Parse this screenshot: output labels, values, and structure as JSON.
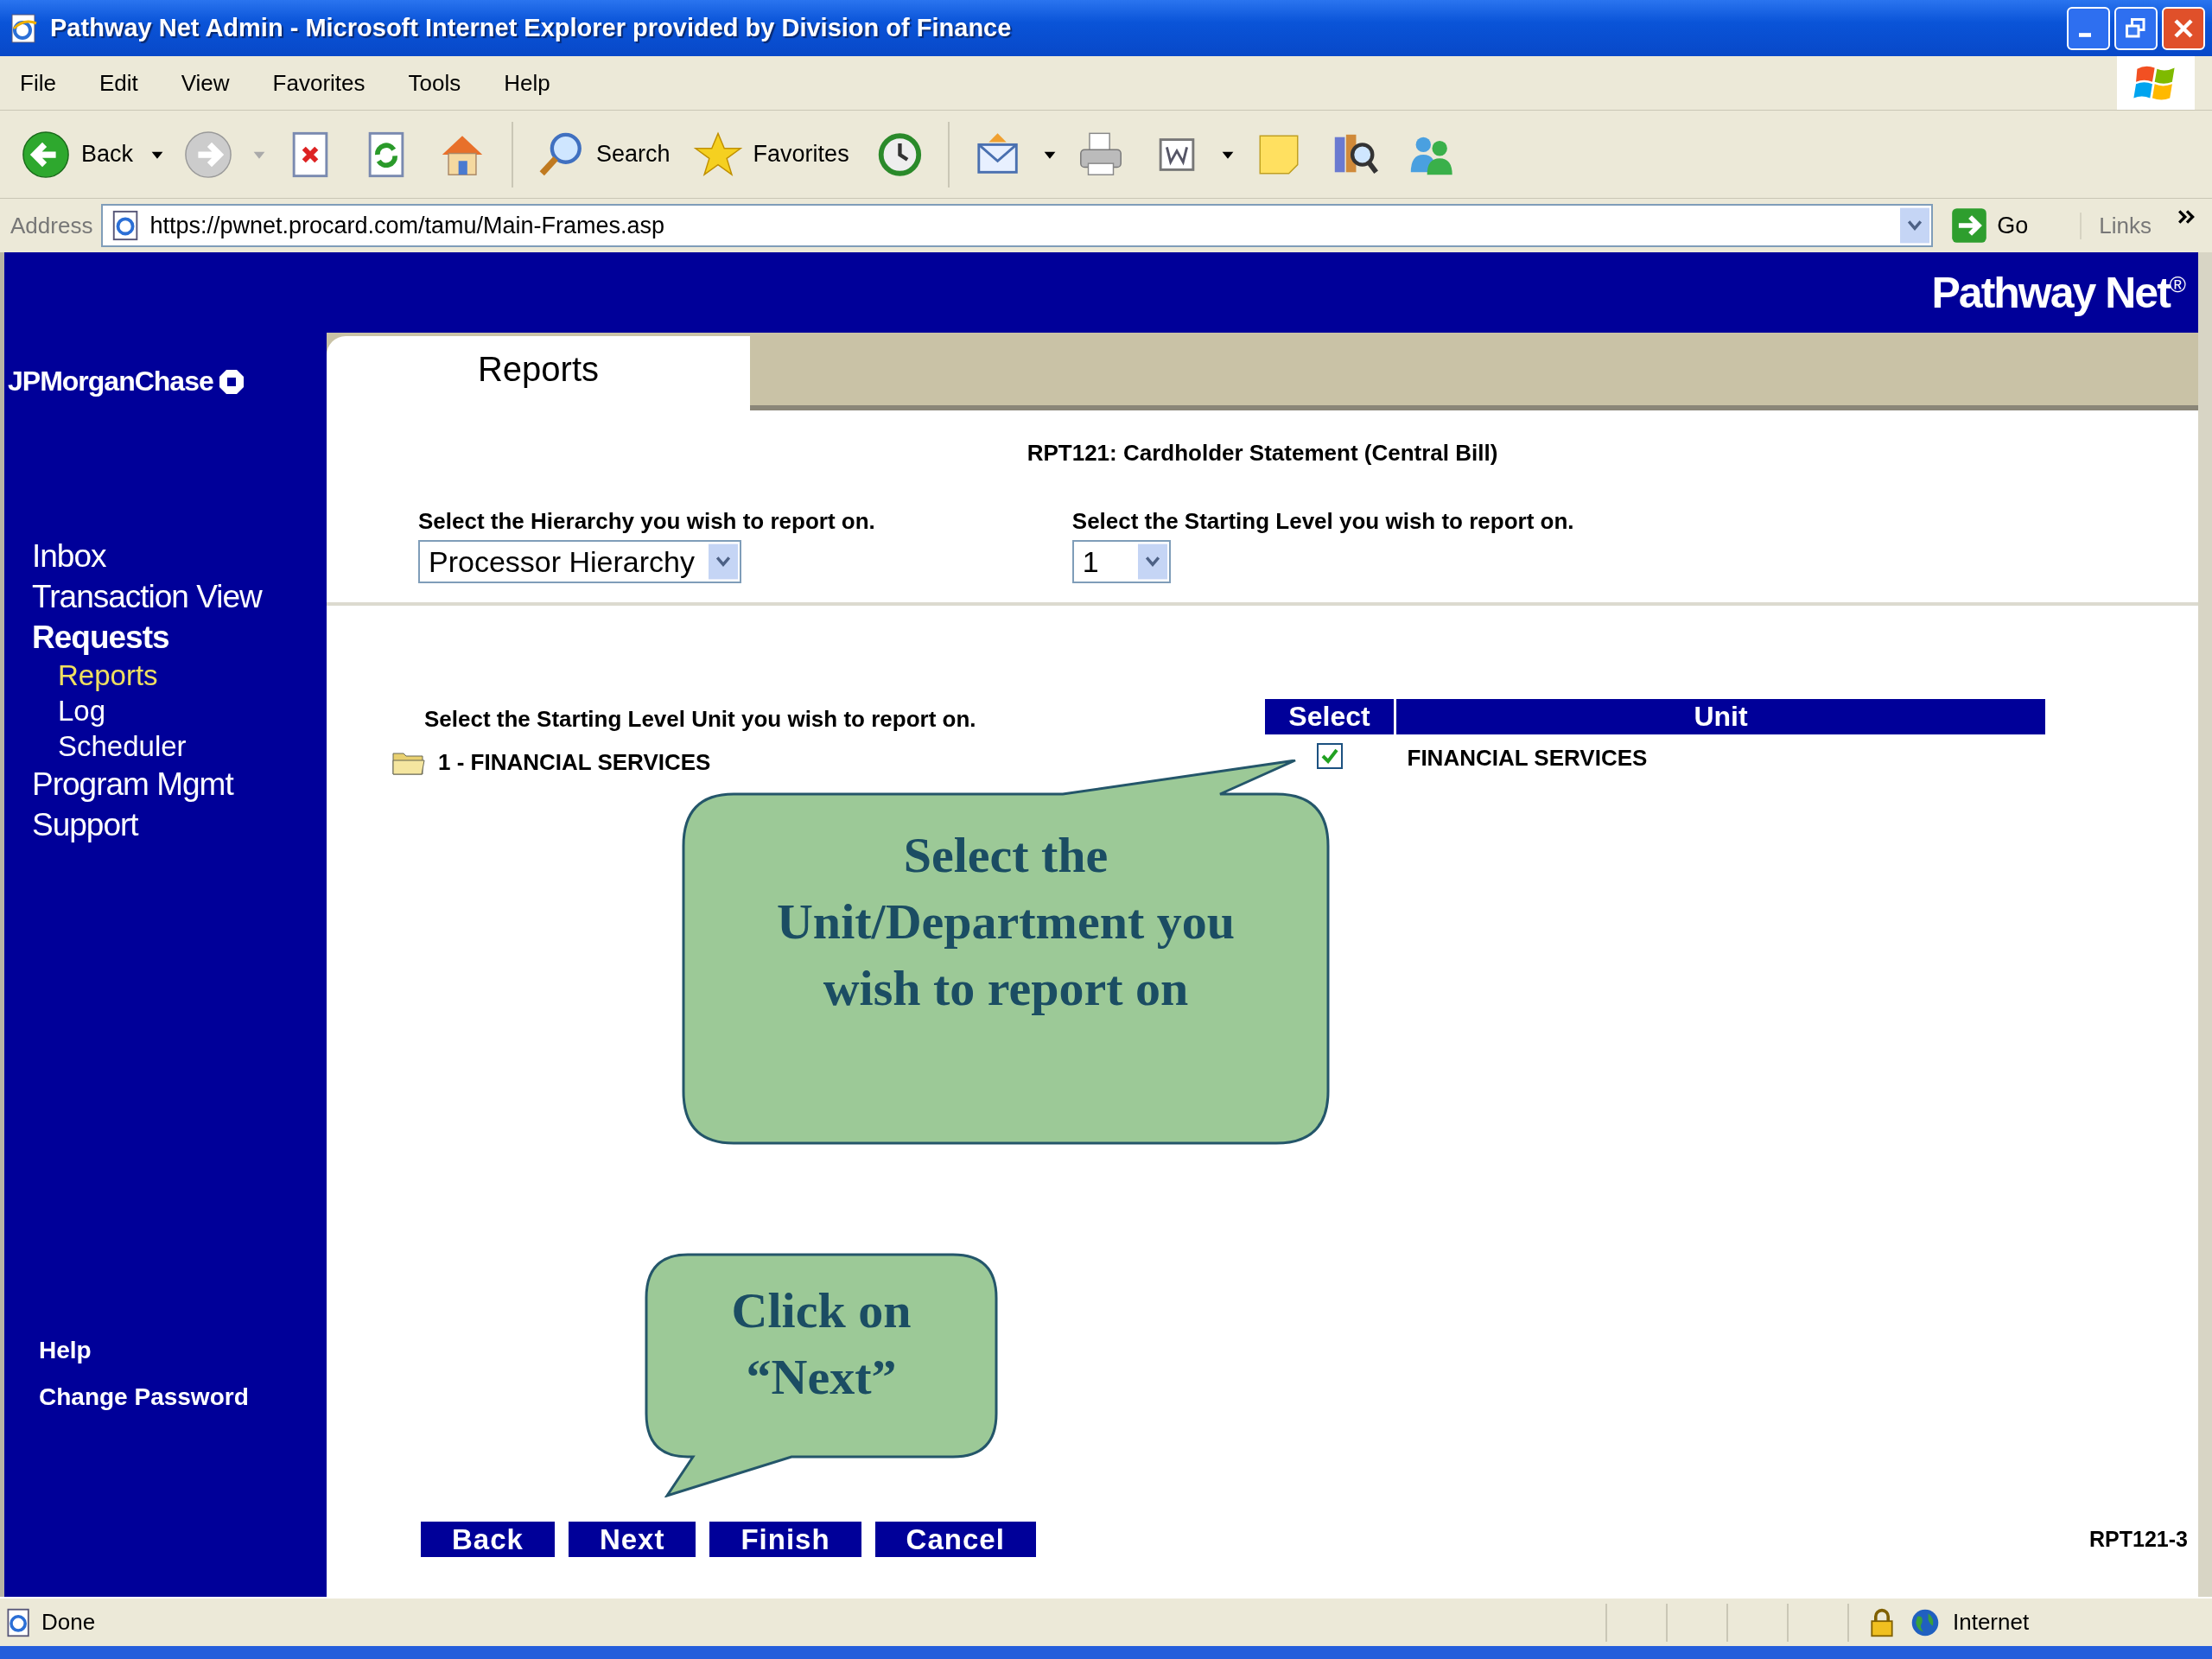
{
  "window": {
    "title": "Pathway Net Admin - Microsoft Internet Explorer provided by Division of Finance"
  },
  "menu_bar": [
    "File",
    "Edit",
    "View",
    "Favorites",
    "Tools",
    "Help"
  ],
  "toolbar": {
    "back": "Back",
    "search": "Search",
    "favorites": "Favorites"
  },
  "address_bar": {
    "label": "Address",
    "value": "https://pwnet.procard.com/tamu/Main-Frames.asp",
    "go": "Go",
    "links": "Links"
  },
  "header": {
    "brand": "Pathway Net$^{®}$"
  },
  "sidebar": {
    "logo": "JPMorganChase",
    "nav": [
      {
        "label": "Inbox",
        "expanded": false
      },
      {
        "label": "Transaction View",
        "expanded": false
      },
      {
        "label": "Requests",
        "expanded": true,
        "children": [
          {
            "label": "Reports",
            "selected": true
          },
          {
            "label": "Log",
            "selected": false
          },
          {
            "label": "Scheduler",
            "selected": false
          }
        ]
      },
      {
        "label": "Program Mgmt",
        "expanded": false
      },
      {
        "label": "Support",
        "expanded": false
      }
    ],
    "bottom_links": [
      "Help",
      "Change Password"
    ]
  },
  "tabs": [
    {
      "label": "Reports",
      "selected": true
    }
  ],
  "report_title": "RPT121: Cardholder Statement (Central Bill)",
  "hierarchy": {
    "label": "Select the Hierarchy you wish to report on.",
    "value": "Processor Hierarchy"
  },
  "starting_level": {
    "label": "Select the Starting Level you wish to report on.",
    "value": "1"
  },
  "units": {
    "label": "Select the Starting Level Unit you wish to report on.",
    "tree": [
      {
        "label": "1 - FINANCIAL SERVICES"
      }
    ],
    "columns": [
      "Select",
      "Unit"
    ],
    "rows": [
      {
        "checked": true,
        "unit": "FINANCIAL SERVICES"
      }
    ]
  },
  "buttons": [
    "Back",
    "Next",
    "Finish",
    "Cancel"
  ],
  "page_id": "RPT121-3",
  "callouts": [
    {
      "lines": [
        "Select the",
        "Unit/Department you",
        "wish to report on"
      ]
    },
    {
      "lines": [
        "Click on",
        "“Next”"
      ]
    }
  ],
  "status_bar": {
    "text": "Done",
    "zone": "Internet"
  }
}
